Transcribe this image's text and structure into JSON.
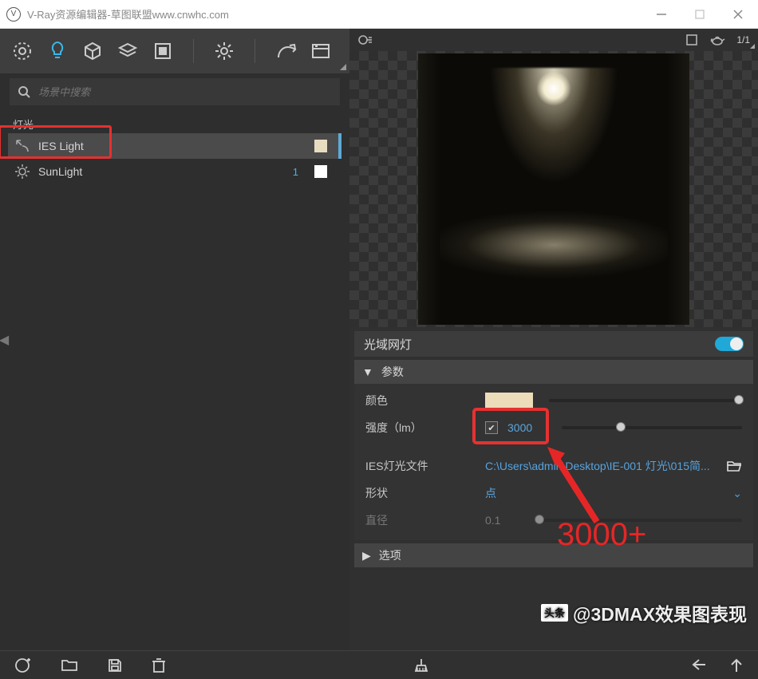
{
  "window": {
    "title": "V-Ray资源编辑器-草图联盟www.cnwhc.com"
  },
  "search": {
    "placeholder": "场景中搜索"
  },
  "sections": {
    "lights": "灯光"
  },
  "lights": {
    "items": [
      {
        "name": "IES Light",
        "count": ""
      },
      {
        "name": "SunLight",
        "count": "1"
      }
    ]
  },
  "preview": {
    "ratio": "1/1"
  },
  "props": {
    "header": "光域网灯",
    "params_title": "参数",
    "color_label": "颜色",
    "intensity_label": "强度（lm）",
    "intensity_value": "3000",
    "iesfile_label": "IES灯光文件",
    "iesfile_value": "C:\\Users\\admin\\Desktop\\IE-001 灯光\\015简...",
    "shape_label": "形状",
    "shape_value": "点",
    "diameter_label": "直径",
    "diameter_value": "0.1",
    "options_title": "选项"
  },
  "annotation": {
    "big": "3000+"
  },
  "watermark": {
    "tag": "头条",
    "text": "@3DMAX效果图表现"
  }
}
